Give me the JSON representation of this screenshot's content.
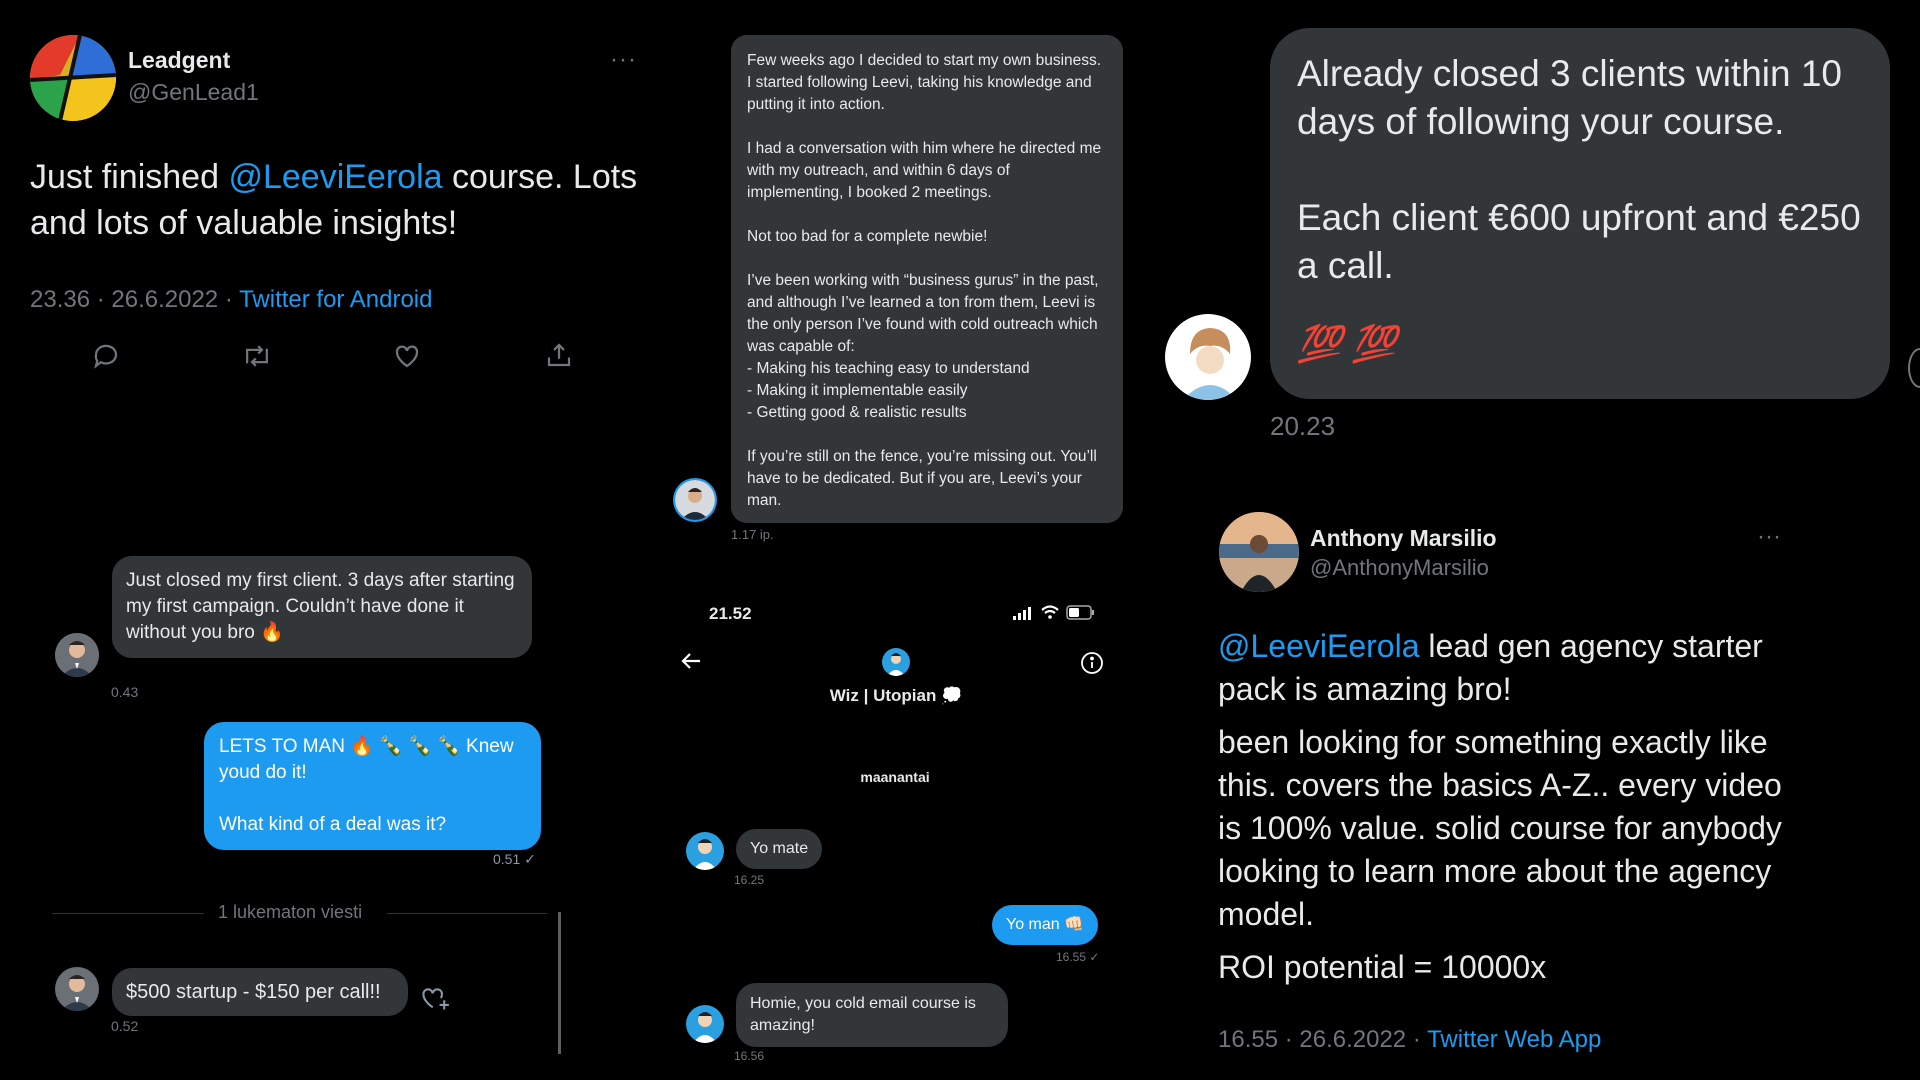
{
  "tweet1": {
    "name": "Leadgent",
    "handle": "@GenLead1",
    "more": "···",
    "text_before": "Just finished ",
    "mention": "@LeeviEerola",
    "text_after": " course. Lots and lots of valuable insights!",
    "meta": "23.36 · 26.6.2022 · ",
    "source": "Twitter for Android"
  },
  "dm1": {
    "msg1": "Just closed my first client. 3 days after starting my first campaign. Couldn’t have done it without you bro 🔥",
    "time1": "0.43",
    "msg2_line1": "LETS TO MAN 🔥 🍾 🍾 🍾 Knew youd do it!",
    "msg2_line2": "What kind of a deal was it?",
    "time2": "0.51 ✓",
    "unread": "1 lukematon viesti",
    "msg3": "$500 startup - $150 per call!!",
    "time3": "0.52"
  },
  "testimonial": {
    "p1": "Few weeks ago I decided to start my own business. I started following Leevi, taking his knowledge and putting it into action.",
    "p2": "I had a conversation with him where he directed me with my outreach, and within 6 days of implementing, I booked 2 meetings.",
    "p3": "Not too bad for a complete newbie!",
    "p4": "I’ve been working with “business gurus” in the past, and although I’ve learned a ton from them, Leevi is the only person I’ve found with cold outreach which was capable of:",
    "b1": "- Making his teaching easy to understand",
    "b2": "- Making it implementable easily",
    "b3": "- Getting good & realistic results",
    "p5": "If you’re still on the fence, you’re missing out. You’ll have to be dedicated. But if you are, Leevi’s your man.",
    "time": "1.17 ip."
  },
  "phone": {
    "clock": "21.52",
    "contact": "Wiz | Utopian 💭",
    "day": "maanantai",
    "m1": "Yo mate",
    "t1": "16.25",
    "m2": "Yo man 👊🏻",
    "t2": "16.55 ✓",
    "m3": "Homie, you cold email course is amazing!",
    "t3": "16.56"
  },
  "dm3": {
    "line1": "Already closed 3 clients within 10 days of following your course.",
    "line2": "Each client €600 upfront and €250 a call.",
    "emoji": "💯 💯",
    "time": "20.23"
  },
  "tweet2": {
    "name": "Anthony Marsilio",
    "handle": "@AnthonyMarsilio",
    "more": "···",
    "mention": "@LeeviEerola",
    "line1_after": " lead gen agency starter pack is amazing bro!",
    "para2": "been looking for something exactly like this. covers the basics A-Z.. every video is 100% value. solid course for anybody looking to learn more about the agency model.",
    "para3": "ROI potential = 10000x",
    "meta": "16.55 · 26.6.2022 · ",
    "source": "Twitter Web App"
  },
  "colors": {
    "accent": "#1d9bf0",
    "bubble": "#333639",
    "muted": "#71767b"
  }
}
